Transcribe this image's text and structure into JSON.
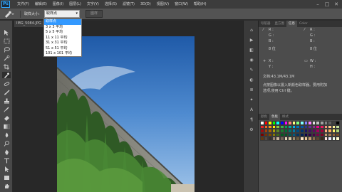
{
  "app": {
    "logo": "Ps"
  },
  "menu": [
    "文件(F)",
    "编辑(E)",
    "图像(I)",
    "图层(L)",
    "文字(Y)",
    "选择(S)",
    "滤镜(T)",
    "3D(D)",
    "视图(V)",
    "窗口(W)",
    "帮助(H)"
  ],
  "options_bar": {
    "sample_size_label": "取样大小:",
    "sample_size_value": "取样点",
    "sample_all_layers": "图样"
  },
  "dropdown": {
    "options": [
      "取样点",
      "3 x 3 平均",
      "5 x 5 平均",
      "11 x 11 平均",
      "31 x 31 平均",
      "51 x 51 平均",
      "101 x 101 平均"
    ],
    "selected_index": 0
  },
  "document": {
    "tab_title": "IMG_5084.JPG"
  },
  "panels": {
    "top_tabs": [
      "导航器",
      "直方图",
      "信息",
      "Color"
    ],
    "info": {
      "r": "R :",
      "g": "G :",
      "b": "B :",
      "bits": "8 位",
      "x": "X :",
      "y": "Y :",
      "w": "W :",
      "h": "H :",
      "doc": "文档:43.1M/43.1M",
      "hint_line1": "点按图像以置入新颜色取样器。要用附加",
      "hint_line2": "选项,使用 Ctrl 键。"
    },
    "bottom_tabs": [
      "颜色",
      "色板",
      "样式"
    ]
  },
  "colors": {
    "menubar": "#3c3c3c",
    "optionsbar": "#535353",
    "panel": "#4c4c4c",
    "dropdown_highlight": "#3399ff",
    "swatches": [
      "#ffffff",
      "#ff0000",
      "#ffff00",
      "#00ff00",
      "#00ffff",
      "#0000ff",
      "#ff00ff",
      "#ff8080",
      "#ffff80",
      "#80ff80",
      "#80ffff",
      "#8080ff",
      "#ff80ff",
      "#e0e0e0",
      "#c0c0c0",
      "#a0a0a0",
      "#808080",
      "#606060",
      "#404040",
      "#000000",
      "#ed1c24",
      "#f26522",
      "#f7941d",
      "#fff200",
      "#8dc63f",
      "#39b54a",
      "#00a651",
      "#00a99d",
      "#00aeef",
      "#0072bc",
      "#0054a6",
      "#2e3192",
      "#662d91",
      "#92278f",
      "#ec008c",
      "#ed145b",
      "#f69679",
      "#fdc68a",
      "#fff799",
      "#c4df9b",
      "#9e0b0f",
      "#a0410d",
      "#a36209",
      "#aba000",
      "#598527",
      "#1a7b30",
      "#007236",
      "#00746b",
      "#0076a3",
      "#004b80",
      "#003471",
      "#1b1464",
      "#440e62",
      "#630460",
      "#9e005d",
      "#9e0039",
      "#f9ad81",
      "#fbaf5d",
      "#fff568",
      "#acd373",
      "#790000",
      "#7b2e00",
      "#7d4900",
      "#827b00",
      "#406618",
      "#005e20",
      "#005826",
      "#005952",
      "#005b7f",
      "#003663",
      "#002157",
      "#0d004c",
      "#32004b",
      "#4b0049",
      "#7b0046",
      "#7a0026",
      "#c69c6d",
      "#a67c52",
      "#8c6239",
      "#754c24",
      "#603913",
      "#534741",
      "#362f2d",
      "#998675",
      "#c7b299",
      "#736357",
      "#e6d7b8",
      "#d1c6a2",
      "#9c8b6b",
      "#6b5a3c",
      "#fbe0c2",
      "#eec99b",
      "#c49c72",
      "#8b6a4a",
      "#5c4430",
      "#3b2a1c",
      "#ffe4e1",
      "#e6e6fa",
      "#f0fff0",
      "#fffacd"
    ]
  }
}
